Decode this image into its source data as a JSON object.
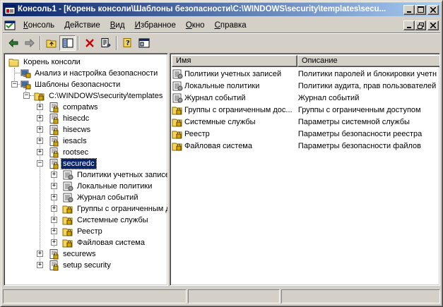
{
  "window": {
    "title": "Консоль1 - [Корень консоли\\Шаблоны безопасности\\C:\\WINDOWS\\security\\templates\\secu..."
  },
  "menu": {
    "items": [
      {
        "first": "К",
        "rest": "онсоль"
      },
      {
        "first": "Д",
        "rest": "ействие"
      },
      {
        "first": "В",
        "rest": "ид"
      },
      {
        "first": "И",
        "rest": "збранное"
      },
      {
        "first": "О",
        "rest": "кно"
      },
      {
        "first": "С",
        "rest": "правка"
      }
    ]
  },
  "toolbar": {
    "icons": [
      "back-arrow-icon",
      "forward-arrow-icon",
      "up-folder-icon",
      "show-tree-icon",
      "delete-icon",
      "export-list-icon",
      "help-icon",
      "console-tree-icon"
    ]
  },
  "tree": {
    "nodes": [
      {
        "label": "Корень консоли",
        "icon": "folder"
      },
      {
        "label": "Анализ и настройка безопасности",
        "icon": "security"
      },
      {
        "label": "Шаблоны безопасности",
        "icon": "security"
      },
      {
        "label": "C:\\WINDOWS\\security\\templates",
        "icon": "folder-lock"
      },
      {
        "label": "compatws",
        "icon": "template"
      },
      {
        "label": "hisecdc",
        "icon": "template"
      },
      {
        "label": "hisecws",
        "icon": "template"
      },
      {
        "label": "iesacls",
        "icon": "template"
      },
      {
        "label": "rootsec",
        "icon": "template"
      },
      {
        "label": "securedc",
        "icon": "template"
      },
      {
        "label": "Политики учетных записей",
        "icon": "policy"
      },
      {
        "label": "Локальные политики",
        "icon": "policy"
      },
      {
        "label": "Журнал событий",
        "icon": "policy"
      },
      {
        "label": "Группы с ограниченным доступом",
        "icon": "folder-lock"
      },
      {
        "label": "Системные службы",
        "icon": "folder-lock"
      },
      {
        "label": "Реестр",
        "icon": "folder-lock"
      },
      {
        "label": "Файловая система",
        "icon": "folder-lock"
      },
      {
        "label": "securews",
        "icon": "template"
      },
      {
        "label": "setup security",
        "icon": "template"
      }
    ]
  },
  "list": {
    "columns": [
      "Имя",
      "Описание"
    ],
    "rows": [
      {
        "name": "Политики учетных записей",
        "desc": "Политики паролей и блокировки учетн",
        "icon": "policy"
      },
      {
        "name": "Локальные политики",
        "desc": "Политики аудита, прав пользователей",
        "icon": "policy"
      },
      {
        "name": "Журнал событий",
        "desc": "Журнал событий",
        "icon": "policy"
      },
      {
        "name": "Группы с ограниченным дос...",
        "desc": "Группы с ограниченным доступом",
        "icon": "folder-lock"
      },
      {
        "name": "Системные службы",
        "desc": "Параметры системной службы",
        "icon": "folder-lock"
      },
      {
        "name": "Реестр",
        "desc": "Параметры безопасности реестра",
        "icon": "folder-lock"
      },
      {
        "name": "Файловая система",
        "desc": "Параметры безопасности файлов",
        "icon": "folder-lock"
      }
    ]
  },
  "colors": {
    "title_start": "#0a246a",
    "title_end": "#a6caf0",
    "face": "#d4d0c8",
    "selection": "#0a246a"
  }
}
